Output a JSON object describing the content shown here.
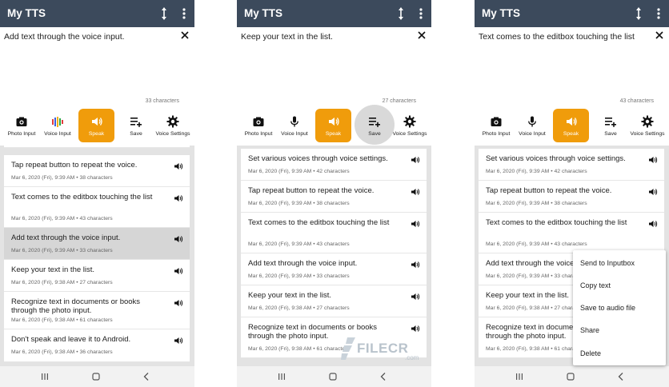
{
  "app": {
    "title": "My TTS"
  },
  "screens": [
    {
      "editor_text": "Add text through the voice input.",
      "char_count": "33 characters",
      "items": [
        {
          "text": "Tap repeat button to repeat the voice.",
          "date": "Mar 6, 2020 (Fri), 9:39 AM",
          "count": "38 characters"
        },
        {
          "text": "Text comes to the editbox touching the list",
          "date": "Mar 6, 2020 (Fri), 9:39 AM",
          "count": "43 characters"
        },
        {
          "text": "Add text through the voice input.",
          "date": "Mar 6, 2020 (Fri), 9:39 AM",
          "count": "33 characters"
        },
        {
          "text": "Keep your text in the list.",
          "date": "Mar 6, 2020 (Fri), 9:38 AM",
          "count": "27 characters"
        },
        {
          "text": "Recognize text in documents or books through the photo input.",
          "date": "Mar 6, 2020 (Fri), 9:38 AM",
          "count": "61 characters"
        },
        {
          "text": "Don't speak and leave it to Android.",
          "date": "Mar 6, 2020 (Fri), 9:38 AM",
          "count": "36 characters"
        }
      ]
    },
    {
      "editor_text": "Keep your text in the list.",
      "char_count": "27 characters",
      "items": [
        {
          "text": "Set various voices through voice settings.",
          "date": "Mar 6, 2020 (Fri), 9:39 AM",
          "count": "42 characters"
        },
        {
          "text": "Tap repeat button to repeat the voice.",
          "date": "Mar 6, 2020 (Fri), 9:39 AM",
          "count": "38 characters"
        },
        {
          "text": "Text comes to the editbox touching the list",
          "date": "Mar 6, 2020 (Fri), 9:39 AM",
          "count": "43 characters"
        },
        {
          "text": "Add text through the voice input.",
          "date": "Mar 6, 2020 (Fri), 9:39 AM",
          "count": "33 characters"
        },
        {
          "text": "Keep your text in the list.",
          "date": "Mar 6, 2020 (Fri), 9:38 AM",
          "count": "27 characters"
        },
        {
          "text": "Recognize text in documents or books through the photo input.",
          "date": "Mar 6, 2020 (Fri), 9:38 AM",
          "count": "61 characters"
        }
      ]
    },
    {
      "editor_text": "Text comes to the editbox touching the list",
      "char_count": "43 characters",
      "items": [
        {
          "text": "Set various voices through voice settings.",
          "date": "Mar 6, 2020 (Fri), 9:39 AM",
          "count": "42 characters"
        },
        {
          "text": "Tap repeat button to repeat the voice.",
          "date": "Mar 6, 2020 (Fri), 9:39 AM",
          "count": "38 characters"
        },
        {
          "text": "Text comes to the editbox touching the list",
          "date": "Mar 6, 2020 (Fri), 9:39 AM",
          "count": "43 characters"
        },
        {
          "text": "Add text through the voice input.",
          "date": "Mar 6, 2020 (Fri), 9:39 AM",
          "count": "33 characters"
        },
        {
          "text": "Keep your text in the list.",
          "date": "Mar 6, 2020 (Fri), 9:38 AM",
          "count": "27 characters"
        },
        {
          "text": "Recognize text in documents or books through the photo input.",
          "date": "Mar 6, 2020 (Fri), 9:38 AM",
          "count": "61 characters"
        }
      ]
    }
  ],
  "toolbar": {
    "photo_input": "Photo Input",
    "voice_input": "Voice Input",
    "speak": "Speak",
    "save": "Save",
    "voice_settings": "Voice Settings"
  },
  "context_menu": [
    "Send to Inputbox",
    "Copy text",
    "Save to audio file",
    "Share",
    "Delete"
  ],
  "watermark": {
    "brand": "FILECR",
    "domain": ".com"
  },
  "colors": {
    "appbar": "#3c4a5c",
    "accent": "#f09c0b",
    "list_bg": "#e3e3e3",
    "highlight": "#d6d6d6"
  }
}
